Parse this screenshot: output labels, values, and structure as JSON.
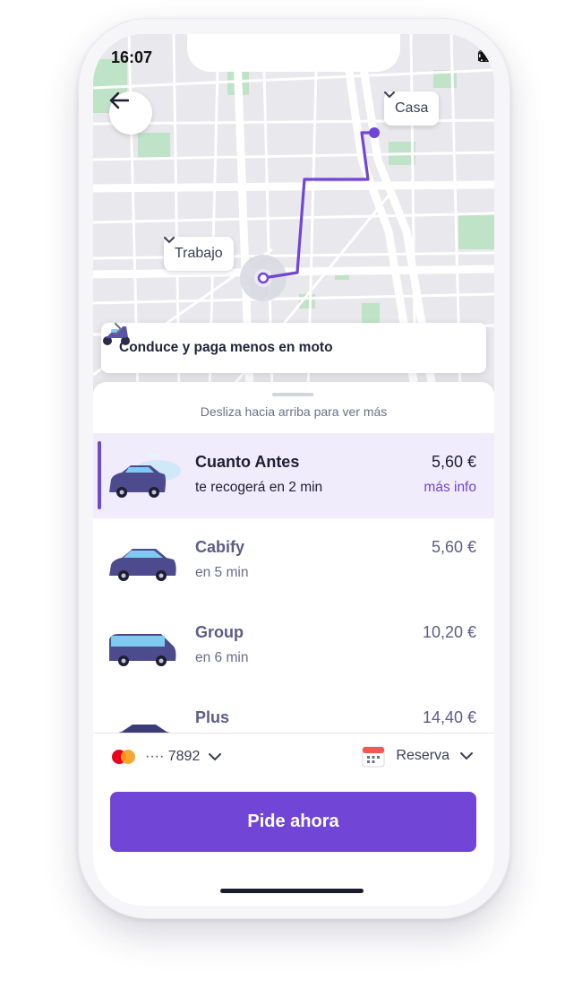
{
  "status_bar": {
    "time": "16:07"
  },
  "map": {
    "destination_label": "Casa",
    "origin_label": "Trabajo",
    "route_color": "#7145d6"
  },
  "promo": {
    "text": "Conduce y paga menos en moto"
  },
  "sheet": {
    "hint": "Desliza hacia arriba para ver más",
    "options": [
      {
        "name": "Cuanto Antes",
        "eta": "te recogerá en 2 min",
        "price": "5,60 €",
        "more": "más info",
        "selected": true
      },
      {
        "name": "Cabify",
        "eta": "en 5 min",
        "price": "5,60 €"
      },
      {
        "name": "Group",
        "eta": "en 6 min",
        "price": "10,20 €"
      },
      {
        "name": "Plus",
        "eta": "",
        "price": "14,40 €"
      }
    ]
  },
  "payment": {
    "card": "···· 7892",
    "icon": "mastercard-icon"
  },
  "reserve": {
    "label": "Reserva",
    "icon": "calendar-icon"
  },
  "cta": {
    "label": "Pide ahora"
  },
  "colors": {
    "accent": "#7145d6",
    "selected_bg": "#f1ecfb"
  }
}
